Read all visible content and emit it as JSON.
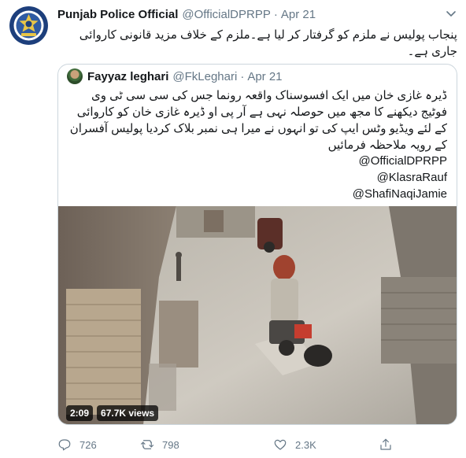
{
  "tweet": {
    "author_name": "Punjab Police Official",
    "handle": "@OfficialDPRPP",
    "separator": "·",
    "time": "Apr 21",
    "text": "پنجاب پولیس نے ملزم کو گرفتار کر لیا ہے۔ملزم کے خلاف مزید قانونی کاروائی جاری ہے۔"
  },
  "quoted": {
    "author_name": "Fayyaz leghari",
    "handle": "@FkLeghari",
    "separator": "·",
    "time": "Apr 21",
    "text": "ڈیرہ غازی خان میں ایک افسوسناک واقعہ رونما جس کی سی سی ٹی وی فوٹیج دیکھنے کا مجھ میں حوصلہ نہی ہے آر پی او ڈیرہ غازی خان کو کاروائی کے لئے ویڈیو وٹس ایپ کی تو انہوں نے میرا ہی نمبر بلاک کردیا پولیس آفسران کے رویہ ملاحظہ فرمائیں",
    "mentions": [
      "@OfficialDPRPP",
      "@KlasraRauf",
      "@ShafiNaqiJamie"
    ]
  },
  "video": {
    "duration": "2:09",
    "views": "67.7K views"
  },
  "actions": {
    "replies": "726",
    "retweets": "798",
    "likes": "2.3K"
  },
  "icons": {
    "avatar": "police-badge-icon",
    "caret": "chevron-down-icon",
    "reply": "reply-icon",
    "retweet": "retweet-icon",
    "like": "heart-icon",
    "share": "share-icon"
  },
  "colors": {
    "text": "#14171a",
    "secondary": "#657786",
    "border": "#ccd6dd"
  }
}
